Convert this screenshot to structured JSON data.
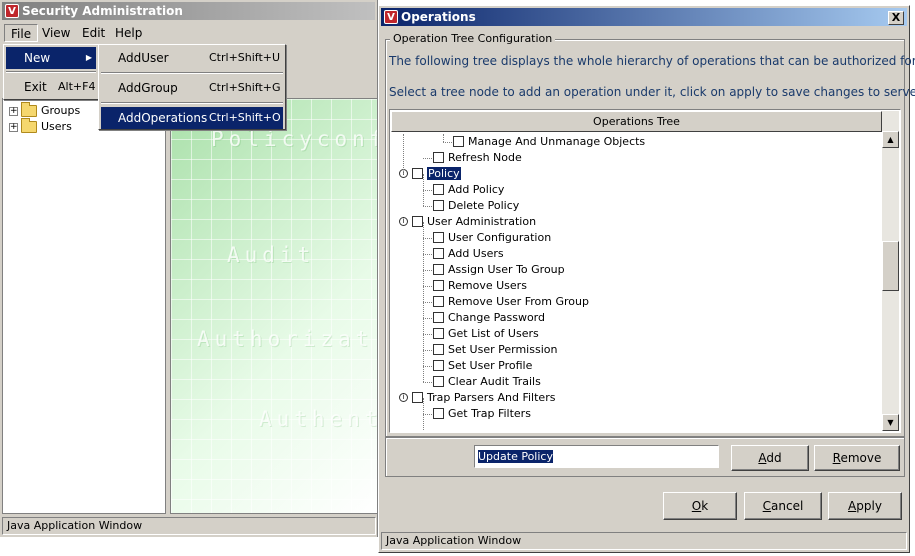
{
  "main_window": {
    "title": "Security Administration",
    "menus": [
      "File",
      "View",
      "Edit",
      "Help"
    ],
    "tree": [
      {
        "label": "Groups",
        "expander": "+"
      },
      {
        "label": "Users",
        "expander": "+"
      }
    ],
    "watermarks": [
      "Policyconf",
      "Audit",
      "Authorizat",
      "Authent"
    ],
    "status": "Java Application Window"
  },
  "file_menu": {
    "new_label": "New",
    "new_arrow": "▶",
    "exit_label": "Exit",
    "exit_accel": "Alt+F4"
  },
  "new_submenu": [
    {
      "label": "AddUser",
      "accel": "Ctrl+Shift+U"
    },
    {
      "label": "AddGroup",
      "accel": "Ctrl+Shift+G"
    },
    {
      "label": "AddOperations",
      "accel": "Ctrl+Shift+O"
    }
  ],
  "ops_dialog": {
    "title": "Operations",
    "close": "X",
    "group_title": "Operation Tree Configuration",
    "info_line1": "The following tree displays the whole hierarchy of operations that can be authorized for users.",
    "info_line2": "Select a tree node to add an operation under it, click on apply to save changes to server",
    "tree_header": "Operations Tree",
    "tree": [
      {
        "label": "Manage And Unmanage Objects",
        "level": 3
      },
      {
        "label": "Refresh Node",
        "level": 2
      },
      {
        "label": "Policy",
        "level": 1,
        "expand": true,
        "selected": true
      },
      {
        "label": "Add Policy",
        "level": 2
      },
      {
        "label": "Delete Policy",
        "level": 2
      },
      {
        "label": "User Administration",
        "level": 1,
        "expand": true
      },
      {
        "label": "User Configuration",
        "level": 2
      },
      {
        "label": "Add Users",
        "level": 2
      },
      {
        "label": "Assign User To Group",
        "level": 2
      },
      {
        "label": "Remove Users",
        "level": 2
      },
      {
        "label": "Remove User From Group",
        "level": 2
      },
      {
        "label": "Change Password",
        "level": 2
      },
      {
        "label": "Get List of Users",
        "level": 2
      },
      {
        "label": "Set User Permission",
        "level": 2
      },
      {
        "label": "Set User Profile",
        "level": 2
      },
      {
        "label": "Clear Audit Trails",
        "level": 2
      },
      {
        "label": "Trap Parsers And Filters",
        "level": 1,
        "expand": true
      },
      {
        "label": "Get Trap Filters",
        "level": 2
      }
    ],
    "input_value": "Update Policy",
    "buttons": {
      "add": {
        "mn": "A",
        "rest": "dd"
      },
      "remove": {
        "mn": "R",
        "rest": "emove"
      },
      "ok": {
        "mn": "O",
        "rest": "k"
      },
      "cancel": {
        "mn": "C",
        "rest": "ancel"
      },
      "apply": {
        "mn": "A",
        "rest": "pply"
      }
    },
    "status": "Java Application Window"
  }
}
